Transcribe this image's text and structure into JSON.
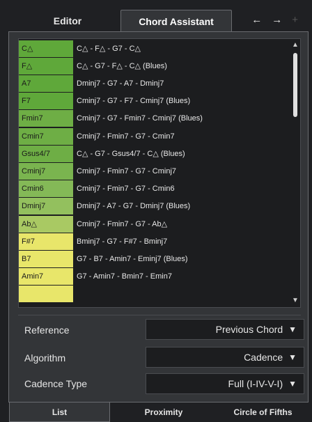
{
  "tabs": {
    "editor": "Editor",
    "chord_assistant": "Chord Assistant"
  },
  "nav": {
    "back_icon": "arrow-left-icon",
    "back": "←",
    "forward_icon": "arrow-right-icon",
    "forward": "→",
    "add_icon": "plus-icon",
    "add": "+"
  },
  "rows": [
    {
      "chord": "C△",
      "progression": "C△ - F△ - G7 - C△",
      "color": "#5fa83a"
    },
    {
      "chord": "F△",
      "progression": "C△ - G7 - F△ - C△ (Blues)",
      "color": "#5fa83a"
    },
    {
      "chord": "A7",
      "progression": "Dminj7 - G7 - A7 - Dminj7",
      "color": "#5fa83a"
    },
    {
      "chord": "F7",
      "progression": "Cminj7 - G7 - F7 - Cminj7 (Blues)",
      "color": "#5fa83a"
    },
    {
      "chord": "Fmin7",
      "progression": "Cminj7 - G7 - Fmin7 - Cminj7 (Blues)",
      "color": "#6eae45"
    },
    {
      "chord": "Cmin7",
      "progression": "Cminj7 - Fmin7 - G7 - Cmin7",
      "color": "#6eae45"
    },
    {
      "chord": "Gsus4/7",
      "progression": "C△ - G7 - Gsus4/7 - C△ (Blues)",
      "color": "#6eae45"
    },
    {
      "chord": "Cminj7",
      "progression": "Cminj7 - Fmin7 - G7 - Cminj7",
      "color": "#7ab44f"
    },
    {
      "chord": "Cmin6",
      "progression": "Cminj7 - Fmin7 - G7 - Cmin6",
      "color": "#84b957"
    },
    {
      "chord": "Dminj7",
      "progression": "Dminj7 - A7 - G7 - Dminj7 (Blues)",
      "color": "#93c05e"
    },
    {
      "chord": "Ab△",
      "progression": "Cminj7 - Fmin7 - G7 - Ab△",
      "color": "#a9c963"
    },
    {
      "chord": "F#7",
      "progression": "Bminj7 - G7 - F#7 - Bminj7",
      "color": "#e8e66a"
    },
    {
      "chord": "B7",
      "progression": "G7 - B7 - Amin7 - Eminj7 (Blues)",
      "color": "#e8e66a"
    },
    {
      "chord": "Amin7",
      "progression": "G7 - Amin7 - Bmin7 - Emin7",
      "color": "#e8e66a"
    },
    {
      "chord": "",
      "progression": "",
      "color": "#e8e66a"
    }
  ],
  "settings": {
    "reference_label": "Reference",
    "reference_value": "Previous Chord",
    "algorithm_label": "Algorithm",
    "algorithm_value": "Cadence",
    "cadence_label": "Cadence Type",
    "cadence_value": "Full (I-IV-V-I)",
    "dropdown_arrow": "▼"
  },
  "bottom_tabs": {
    "list": "List",
    "proximity": "Proximity",
    "circle": "Circle of Fifths"
  }
}
